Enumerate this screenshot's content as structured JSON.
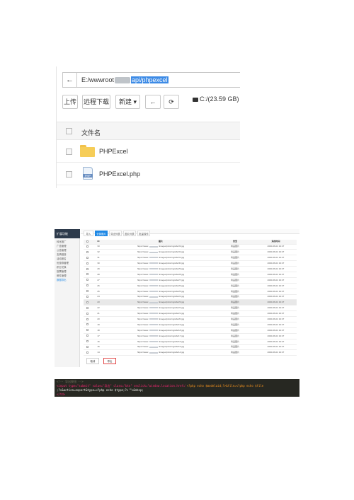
{
  "file_manager": {
    "back_icon": "arrow-left",
    "path_prefix": "E:/wwwroot",
    "path_suffix": "api/phpexcel",
    "buttons": {
      "upload": "上传",
      "remote_download": "远程下载",
      "new": "新建",
      "back_arrow": "←",
      "refresh": "⟳"
    },
    "disk": "C:/(23.59 GB)",
    "column_filename": "文件名",
    "files": [
      {
        "name": "PHPExcel",
        "type": "folder"
      },
      {
        "name": "PHPExcel.php",
        "type": "php"
      }
    ]
  },
  "admin": {
    "sidebar_title": "扩展功能",
    "sidebar_items": [
      "转化推广",
      "广告管理",
      "公告管理",
      "友情链接",
      "活动报名",
      "优惠券管理",
      "积分兑换",
      "投票管理",
      "邮件管理",
      "数据导出"
    ],
    "tabs": [
      "导入",
      "全部图片",
      "导出列表",
      "图片列表",
      "批量操作"
    ],
    "columns": [
      "ID",
      "图片",
      "类型",
      "添加时间"
    ],
    "rows": [
      {
        "id": "33",
        "path_a": "https://www.",
        "path_b": "/images/pics/img/abc33.jpg",
        "type": "商品图片",
        "time": "2020-06-01 10:27"
      },
      {
        "id": "32",
        "path_a": "https://www.",
        "path_b": "/images/pics/img/abc32.jpg",
        "type": "商品图片",
        "time": "2020-06-01 10:27"
      },
      {
        "id": "31",
        "path_a": "https://www.",
        "path_b": "/images/pics/img/abc31.jpg",
        "type": "商品图片",
        "time": "2020-06-01 10:27"
      },
      {
        "id": "30",
        "path_a": "https://www.",
        "path_b": "/images/pics/img/abc30.jpg",
        "type": "商品图片",
        "time": "2020-06-01 10:27"
      },
      {
        "id": "29",
        "path_a": "https://www.",
        "path_b": "/images/pics/img/abc29.jpg",
        "type": "商品图片",
        "time": "2020-06-01 10:27"
      },
      {
        "id": "28",
        "path_a": "https://www.",
        "path_b": "/images/pics/img/abc28.jpg",
        "type": "商品图片",
        "time": "2020-06-01 10:27"
      },
      {
        "id": "27",
        "path_a": "https://www.",
        "path_b": "/images/pics/img/abc27.jpg",
        "type": "商品图片",
        "time": "2020-06-01 10:27"
      },
      {
        "id": "26",
        "path_a": "https://www.",
        "path_b": "/images/pics/img/abc26.jpg",
        "type": "商品图片",
        "time": "2020-06-01 10:27"
      },
      {
        "id": "25",
        "path_a": "https://www.",
        "path_b": "/images/pics/img/abc25.jpg",
        "type": "商品图片",
        "time": "2020-06-01 10:27"
      },
      {
        "id": "24",
        "path_a": "https://www.",
        "path_b": "/images/pics/img/abc24.jpg",
        "type": "商品图片",
        "time": "2020-06-01 10:27"
      },
      {
        "id": "23",
        "path_a": "https://www.",
        "path_b": "/images/pics/img/abc23.jpg",
        "type": "商品图片",
        "time": "2020-06-01 10:27"
      },
      {
        "id": "22",
        "path_a": "https://www.",
        "path_b": "/images/pics/img/abc22.jpg",
        "type": "商品图片",
        "time": "2020-06-01 10:27"
      },
      {
        "id": "21",
        "path_a": "https://www.",
        "path_b": "/images/pics/img/abc21.jpg",
        "type": "商品图片",
        "time": "2020-06-01 10:27"
      },
      {
        "id": "20",
        "path_a": "https://www.",
        "path_b": "/images/pics/img/abc20.jpg",
        "type": "商品图片",
        "time": "2020-06-01 10:27"
      },
      {
        "id": "19",
        "path_a": "https://www.",
        "path_b": "/images/pics/img/abc19.jpg",
        "type": "商品图片",
        "time": "2020-06-01 10:27"
      },
      {
        "id": "18",
        "path_a": "https://www.",
        "path_b": "/images/pics/img/abc18.jpg",
        "type": "商品图片",
        "time": "2020-06-01 10:27"
      },
      {
        "id": "17",
        "path_a": "https://www.",
        "path_b": "/images/pics/img/abc17.jpg",
        "type": "商品图片",
        "time": "2020-06-01 10:27"
      },
      {
        "id": "16",
        "path_a": "https://www.",
        "path_b": "/images/pics/img/abc16.jpg",
        "type": "商品图片",
        "time": "2020-06-01 10:27"
      },
      {
        "id": "15",
        "path_a": "https://www.",
        "path_b": "/images/pics/img/abc15.jpg",
        "type": "商品图片",
        "time": "2020-06-01 10:27"
      },
      {
        "id": "14",
        "path_a": "https://www.",
        "path_b": "/images/pics/img/abc14.jpg",
        "type": "商品图片",
        "time": "2020-06-01 10:27"
      }
    ],
    "highlight_row": 10,
    "footer_buttons": [
      "取消",
      "导出"
    ]
  },
  "code": {
    "comment": "<!-- 导出按钮 -->",
    "line1_tag": "<input type=\"submit\" value=\"导出\" class=\"btn\" onclick=\"window.location.href='",
    "line1_php": "<?php echo $modelaid;?>&file=<?php echo $file",
    "line2": ";?>&action=export&type=<?php echo $type;?>'\">&nbsp;",
    "line3": "</td>"
  }
}
